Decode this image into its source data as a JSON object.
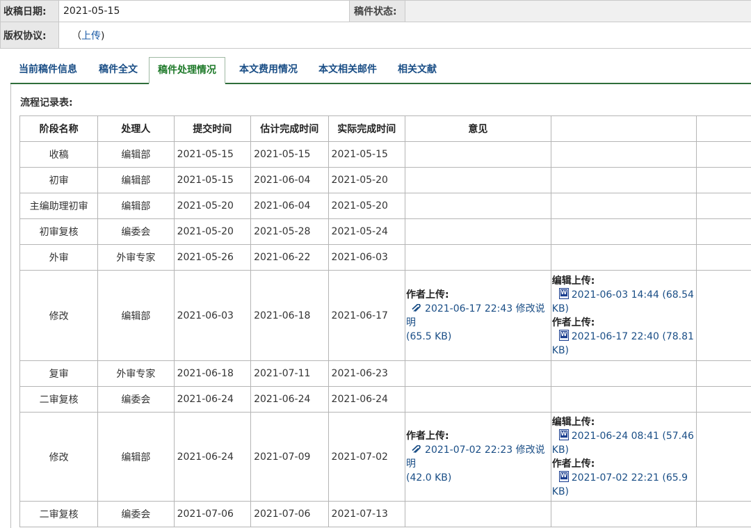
{
  "header": {
    "received_label": "收稿日期:",
    "received_value": "2021-05-15",
    "status_label": "稿件状态:",
    "status_value": "",
    "copyright_label": "版权协议:",
    "copyright_open": "（",
    "copyright_link": "上传",
    "copyright_close": ")"
  },
  "tabs": [
    {
      "label": "当前稿件信息"
    },
    {
      "label": "稿件全文"
    },
    {
      "label": "稿件处理情况"
    },
    {
      "label": "本文费用情况"
    },
    {
      "label": "本文相关邮件"
    },
    {
      "label": "相关文献"
    }
  ],
  "active_tab": 2,
  "flow": {
    "title": "流程记录表:",
    "columns": [
      "阶段名称",
      "处理人",
      "提交时间",
      "估计完成时间",
      "实际完成时间",
      "意见",
      "",
      ""
    ],
    "rows": [
      {
        "stage": "收稿",
        "handler": "编辑部",
        "submit": "2021-05-15",
        "estimate": "2021-05-15",
        "actual": "2021-05-15"
      },
      {
        "stage": "初审",
        "handler": "编辑部",
        "submit": "2021-05-15",
        "estimate": "2021-06-04",
        "actual": "2021-05-20"
      },
      {
        "stage": "主编助理初审",
        "handler": "编辑部",
        "submit": "2021-05-20",
        "estimate": "2021-06-04",
        "actual": "2021-05-20"
      },
      {
        "stage": "初审复核",
        "handler": "编委会",
        "submit": "2021-05-20",
        "estimate": "2021-05-28",
        "actual": "2021-05-24"
      },
      {
        "stage": "外审",
        "handler": "外审专家",
        "submit": "2021-05-26",
        "estimate": "2021-06-22",
        "actual": "2021-06-03"
      },
      {
        "stage": "修改",
        "handler": "编辑部",
        "submit": "2021-06-03",
        "estimate": "2021-06-18",
        "actual": "2021-06-17",
        "opinion": {
          "head": "作者上传:",
          "link": "2021-06-17 22:43 修改说明",
          "size": "(65.5 KB)"
        },
        "files": {
          "editor_head": "编辑上传:",
          "editor_link": "2021-06-03 14:44 (68.54",
          "editor_size": "KB)",
          "author_head": "作者上传:",
          "author_link": "2021-06-17 22:40 (78.81",
          "author_size": "KB)"
        }
      },
      {
        "stage": "复审",
        "handler": "外审专家",
        "submit": "2021-06-18",
        "estimate": "2021-07-11",
        "actual": "2021-06-23"
      },
      {
        "stage": "二审复核",
        "handler": "编委会",
        "submit": "2021-06-24",
        "estimate": "2021-06-24",
        "actual": "2021-06-24"
      },
      {
        "stage": "修改",
        "handler": "编辑部",
        "submit": "2021-06-24",
        "estimate": "2021-07-09",
        "actual": "2021-07-02",
        "opinion": {
          "head": "作者上传:",
          "link": "2021-07-02 22:23 修改说明",
          "size": "(42.0 KB)"
        },
        "files": {
          "editor_head": "编辑上传:",
          "editor_link": "2021-06-24 08:41 (57.46",
          "editor_size": "KB)",
          "author_head": "作者上传:",
          "author_link": "2021-07-02 22:21 (65.9",
          "author_size": "KB)"
        }
      },
      {
        "stage": "二审复核",
        "handler": "编委会",
        "submit": "2021-07-06",
        "estimate": "2021-07-06",
        "actual": "2021-07-13"
      }
    ]
  },
  "icons": {
    "opinion_attachment": "paperclip-icon",
    "file_attachment": "word-document-icon"
  }
}
